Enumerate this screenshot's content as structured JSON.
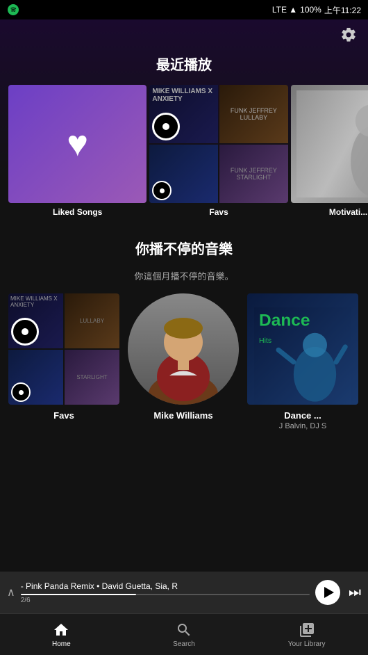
{
  "statusBar": {
    "carrier": "Spotify",
    "network": "LTE",
    "battery": "100%",
    "time": "上午11:22"
  },
  "header": {
    "settingsLabel": "⚙"
  },
  "recentlyPlayed": {
    "sectionTitle": "最近播放",
    "items": [
      {
        "id": "liked-songs",
        "label": "Liked Songs",
        "type": "liked"
      },
      {
        "id": "favs",
        "label": "Favs",
        "type": "collage"
      },
      {
        "id": "motivation",
        "label": "Motivati...",
        "type": "motivation"
      }
    ]
  },
  "youNeverStop": {
    "sectionTitle": "你播不停的音樂",
    "sectionSubtitle": "你這個月播不停的音樂。",
    "items": [
      {
        "id": "favs2",
        "label": "Favs",
        "sublabel": "",
        "type": "collage"
      },
      {
        "id": "mike-williams",
        "label": "Mike Williams",
        "sublabel": "",
        "type": "person"
      },
      {
        "id": "dance",
        "label": "Dance ...",
        "sublabel": "J Balvin, DJ S",
        "type": "dance"
      }
    ]
  },
  "nowPlaying": {
    "trackName": "- Pink Panda Remix • David Guetta, Sia, R",
    "progress": "2/6",
    "chevron": "∧"
  },
  "bottomNav": {
    "items": [
      {
        "id": "home",
        "icon": "⌂",
        "label": "Home",
        "active": true
      },
      {
        "id": "search",
        "icon": "🔍",
        "label": "Search",
        "active": false
      },
      {
        "id": "library",
        "icon": "📚",
        "label": "Your Library",
        "active": false
      }
    ]
  }
}
